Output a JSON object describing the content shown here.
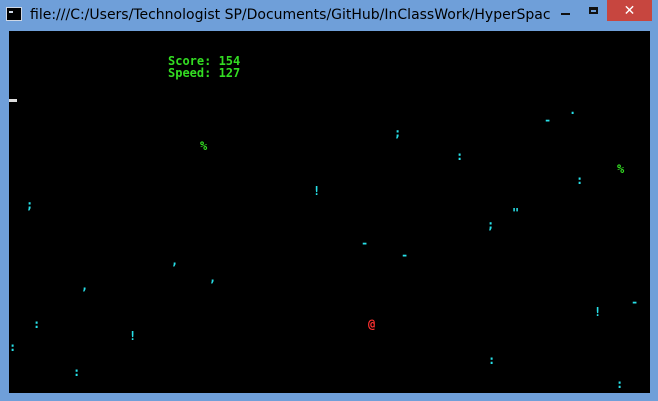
{
  "window": {
    "title": "file:///C:/Users/Technologist SP/Documents/GitHub/InClassWork/HyperSpac...",
    "close_label": "✕"
  },
  "hud": {
    "score_label": "Score: 154",
    "speed_label": "Speed: 127"
  },
  "game": {
    "player_char": "@",
    "stars": [
      ";",
      "%",
      "-",
      ";",
      ":",
      "%",
      ":",
      ".",
      ";",
      ",",
      "\"",
      ",",
      "-",
      "-",
      ",",
      "-",
      ":",
      "!",
      "!",
      ":",
      "!",
      ":",
      ":",
      ":"
    ]
  },
  "colors": {
    "hud": "#33dd22",
    "star": "#27e0e8",
    "player": "#ff3030",
    "background": "#000000",
    "close_button": "#c7463f",
    "window_frame": "#6f9fd9"
  }
}
